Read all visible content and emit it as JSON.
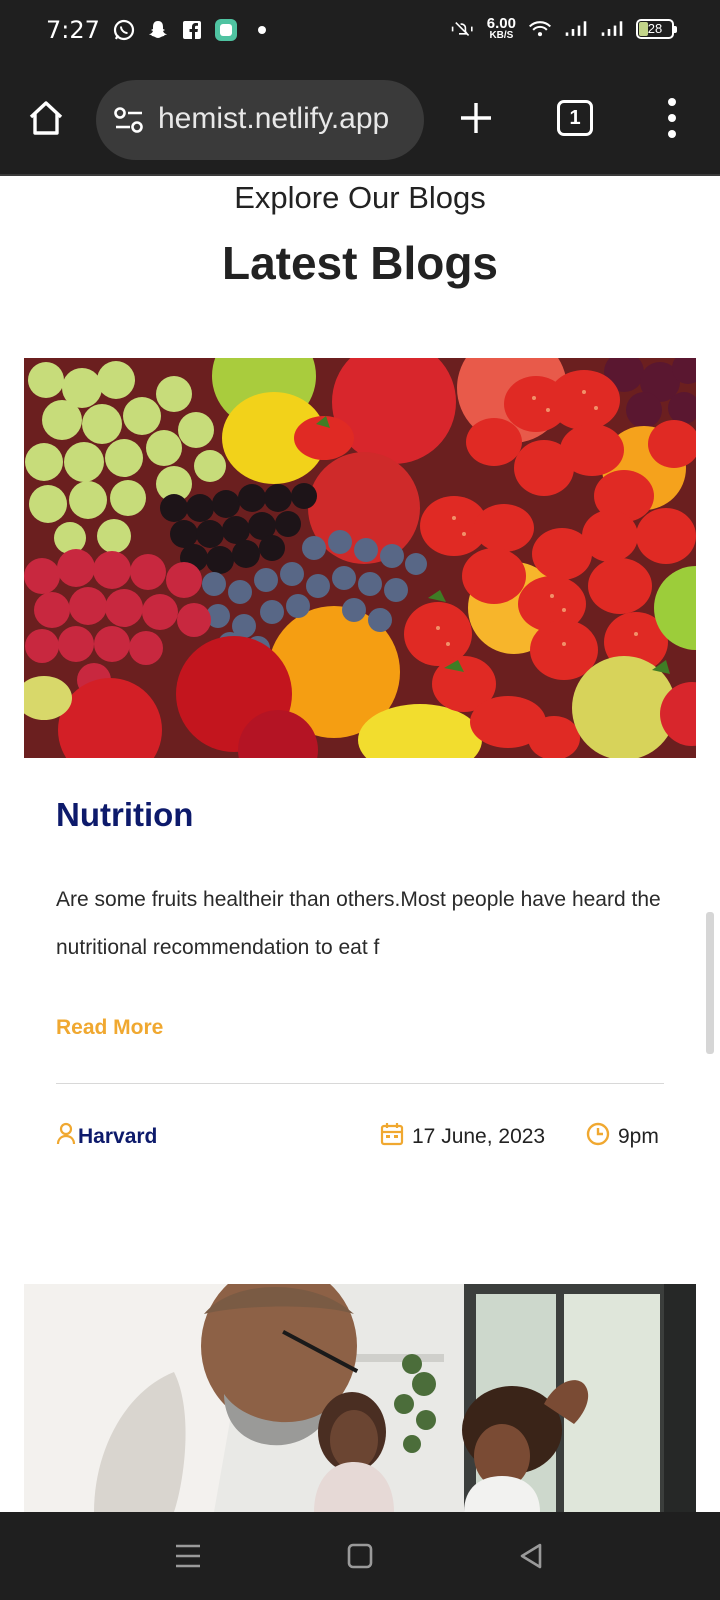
{
  "status_bar": {
    "time": "7:27",
    "net_speed_value": "6.00",
    "net_speed_unit": "KB/S",
    "battery": "28",
    "icons": [
      "whatsapp-icon",
      "snapchat-icon",
      "facebook-icon",
      "app-icon",
      "notification-dot",
      "silent-icon",
      "wifi-icon",
      "signal-icon",
      "signal-icon-2",
      "battery-icon"
    ]
  },
  "browser": {
    "url": "hemist.netlify.app",
    "tab_count": "1",
    "icons": [
      "home-icon",
      "site-settings-icon",
      "new-tab-icon",
      "tabs-icon",
      "more-menu-icon"
    ]
  },
  "page": {
    "subtitle": "Explore Our Blogs",
    "title": "Latest Blogs"
  },
  "posts": [
    {
      "title": "Nutrition",
      "excerpt": "Are some fruits healtheir than others.Most people have heard the nutritional recommendation to eat f",
      "read_more": "Read More",
      "author": "Harvard",
      "date": "17 June, 2023",
      "time": "9pm"
    }
  ],
  "colors": {
    "accent": "#f0a830",
    "title_navy": "#0d1a6b",
    "chrome_dark": "#1f1f1f"
  }
}
